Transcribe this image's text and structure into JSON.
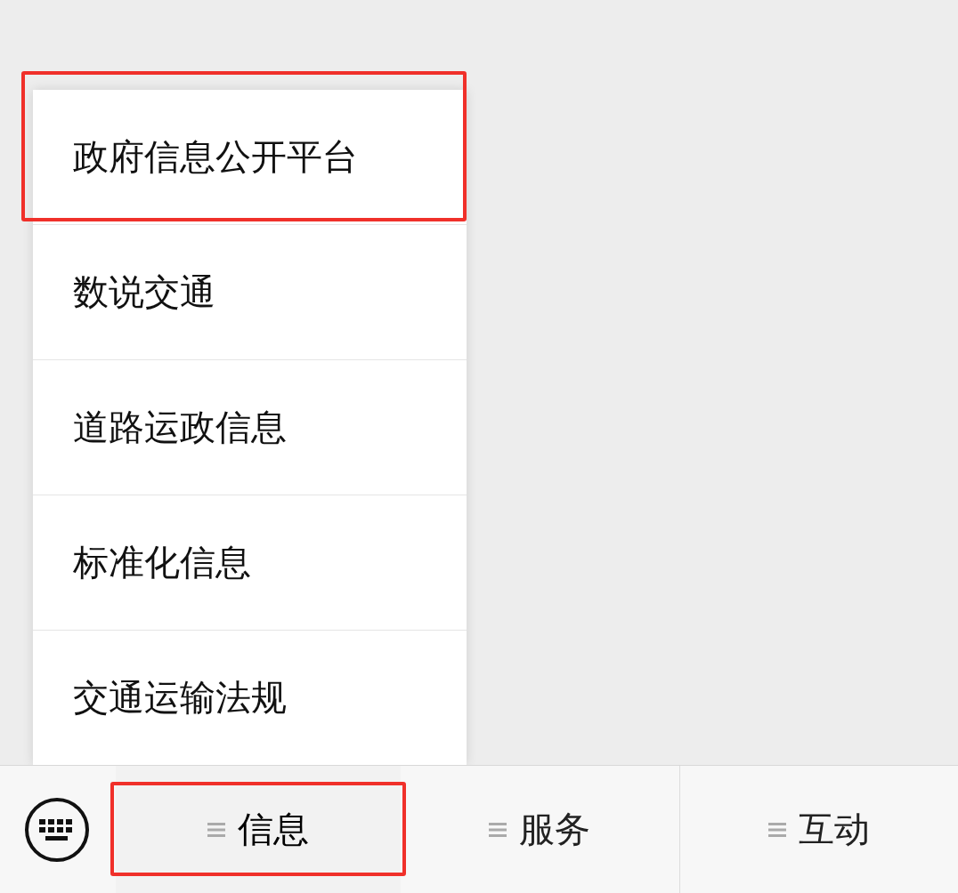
{
  "menu": [
    {
      "label": "政府信息公开平台",
      "highlighted": true
    },
    {
      "label": "数说交通",
      "highlighted": false
    },
    {
      "label": "道路运政信息",
      "highlighted": false
    },
    {
      "label": "标准化信息",
      "highlighted": false
    },
    {
      "label": "交通运输法规",
      "highlighted": false
    }
  ],
  "tabs": [
    {
      "label": "信息",
      "selected": true,
      "highlighted": true
    },
    {
      "label": "服务",
      "selected": false,
      "highlighted": false
    },
    {
      "label": "互动",
      "selected": false,
      "highlighted": false
    }
  ]
}
